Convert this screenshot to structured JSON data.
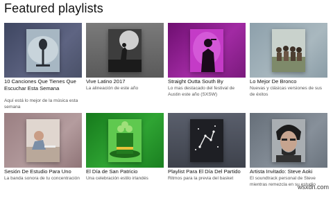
{
  "section_title": "Featured playlists",
  "playlists": [
    {
      "name": "10 Canciones Que Tienes Que Escuchar Esta Semana",
      "desc": "Aquí está lo mejor de la música esta semana",
      "bg": "#4f5570",
      "cover": "#9aa9b6"
    },
    {
      "name": "Vive Latino 2017",
      "desc": "La alineación de este año",
      "bg": "#6a6a6a",
      "cover": "#4a4a4a"
    },
    {
      "name": "Straight Outta South By",
      "desc": "Lo mas destacado del festival de Austin este año (SXSW)",
      "bg": "#8b1f8c",
      "cover": "#b02cb3"
    },
    {
      "name": "Lo Mejor De Bronco",
      "desc": "Nuevas y clásicas versiones de sus de éxitos",
      "bg": "#96a7b0",
      "cover": "#b8c4c0"
    },
    {
      "name": "Sesión De Estudio Para Uno",
      "desc": "La banda sonora de tu concentración",
      "bg": "#a68d8f",
      "cover": "#d2c5bd"
    },
    {
      "name": "El Día de San Patricio",
      "desc": "Una celebración estilo irlandés",
      "bg": "#1f8a26",
      "cover": "#3fb63a"
    },
    {
      "name": "Playlist Para El Día Del Partido",
      "desc": "Ritmos para la previa del basket",
      "bg": "#4a4e5a",
      "cover": "#2a2b31"
    },
    {
      "name": "Artista Invitado: Steve Aoki",
      "desc": "El soundtrack personal de Steve mientras remezcla en su estudio",
      "bg": "#727b85",
      "cover": "#8a8f94"
    }
  ],
  "watermark": "wsxdn.com"
}
